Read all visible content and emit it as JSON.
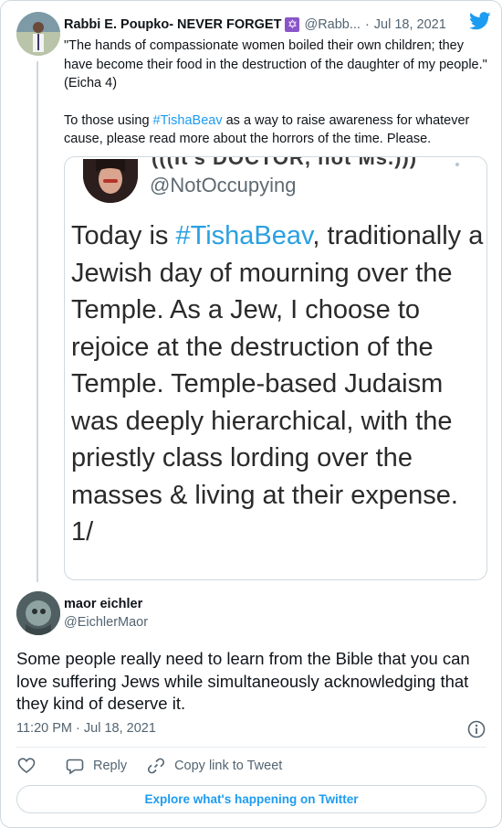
{
  "parent_tweet": {
    "author_name": "Rabbi E. Poupko- NEVER FORGET",
    "name_emoji": "✡",
    "handle": "@Rabb...",
    "separator": "·",
    "date": "Jul 18, 2021",
    "text_line1": "\"The hands of compassionate women boiled their own children; they have become their food in the destruction of the daughter of my people.\" (Eicha 4)",
    "text_para2_before": "To those using ",
    "text_para2_hashtag": "#TishaBeav",
    "text_para2_after": " as a way to raise awareness for whatever cause, please read more about the horrors of the time. Please."
  },
  "embedded_image": {
    "top_name_fragment": "(((It's DOCTOR, not Ms.)))",
    "handle": "@NotOccupying",
    "text_before": "Today is ",
    "hashtag": "#TishaBeav",
    "text_after": ", traditionally a Jewish day of mourning over the Temple. As a Jew, I choose to rejoice at the destruction of the Temple. Temple-based Judaism was deeply hierarchical, with the priestly class lording over the masses & living at their expense. 1/"
  },
  "main_tweet": {
    "author_name": "maor eichler",
    "handle": "@EichlerMaor",
    "text": "Some people really need to learn from the Bible that you can love suffering Jews while simultaneously acknowledging that they kind of deserve it.",
    "timestamp": "11:20 PM · Jul 18, 2021"
  },
  "actions": {
    "reply_label": "Reply",
    "copy_link_label": "Copy link to Tweet"
  },
  "explore_button": {
    "label": "Explore what's happening on Twitter"
  },
  "colors": {
    "accent": "#1d9bf0",
    "secondary_text": "#536471",
    "border": "#cfd9de"
  },
  "icons": {
    "brand": "twitter-bird-icon",
    "info": "info-icon",
    "like": "heart-icon",
    "reply": "reply-bubble-icon",
    "copy": "link-icon"
  }
}
